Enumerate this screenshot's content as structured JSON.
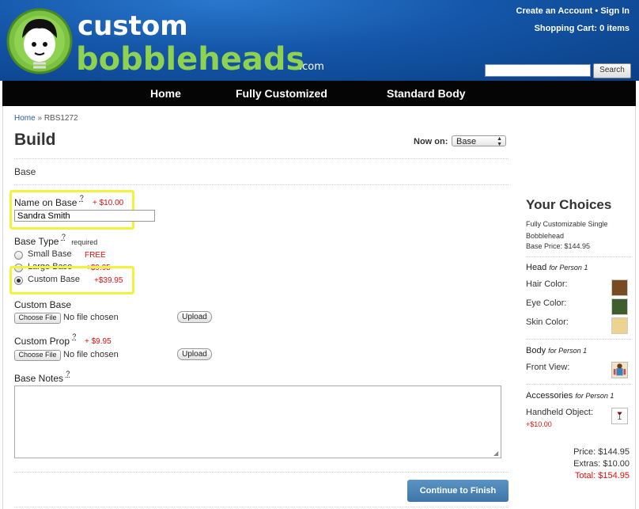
{
  "header": {
    "logo_word1": "custom",
    "logo_word2": "bobbleheads",
    "logo_suffix": ".com",
    "create_account": "Create an Account",
    "separator": "•",
    "sign_in": "Sign In",
    "cart": "Shopping Cart: 0 items",
    "search_placeholder": "",
    "search_button": "Search"
  },
  "nav": {
    "items": [
      "Home",
      "Fully Customized",
      "Standard Body"
    ]
  },
  "breadcrumb": {
    "home": "Home",
    "sep": "»",
    "current": "RBS1272"
  },
  "page": {
    "title": "Build",
    "now_on_label": "Now on:",
    "now_on_value": "Base",
    "section": "Base"
  },
  "form": {
    "name_on_base": {
      "label": "Name on Base",
      "help": "?",
      "price": "+ $10.00",
      "value": "Sandra Smith"
    },
    "base_type": {
      "label": "Base Type",
      "help": "?",
      "required": "required",
      "options": [
        {
          "label": "Small Base",
          "price": "FREE",
          "selected": false
        },
        {
          "label": "Large Base",
          "price": "+$9.95",
          "selected": false
        },
        {
          "label": "Custom Base",
          "price": "+$39.95",
          "selected": true
        }
      ]
    },
    "custom_base": {
      "label": "Custom Base",
      "choose": "Choose File",
      "status": "No file chosen",
      "upload": "Upload"
    },
    "custom_prop": {
      "label": "Custom Prop",
      "help": "?",
      "price": "+ $9.95",
      "choose": "Choose File",
      "status": "No file chosen",
      "upload": "Upload"
    },
    "base_notes": {
      "label": "Base Notes",
      "help": "?",
      "value": ""
    },
    "continue": "Continue to Finish"
  },
  "choices": {
    "title": "Your Choices",
    "product": "Fully Customizable Single Bobblehead",
    "base_price": "Base Price: $144.95",
    "head": {
      "label": "Head",
      "person": "for Person 1",
      "rows": [
        {
          "label": "Hair Color:",
          "color": "#7a4a22"
        },
        {
          "label": "Eye Color:",
          "color": "#3e5e2e"
        },
        {
          "label": "Skin Color:",
          "color": "#ecd48e"
        }
      ]
    },
    "body": {
      "label": "Body",
      "person": "for Person 1",
      "front_view": "Front View:"
    },
    "accessories": {
      "label": "Accessories",
      "person": "for Person 1",
      "handheld": "Handheld Object:",
      "handheld_price": "+$10.00"
    },
    "price": "Price: $144.95",
    "extras": "Extras: $10.00",
    "total": "Total: $154.95"
  },
  "colors": {
    "header_blue": "#1456a8",
    "price_red": "#dd1111",
    "highlight": "#f2f23a",
    "button_blue": "#4a82b5"
  }
}
